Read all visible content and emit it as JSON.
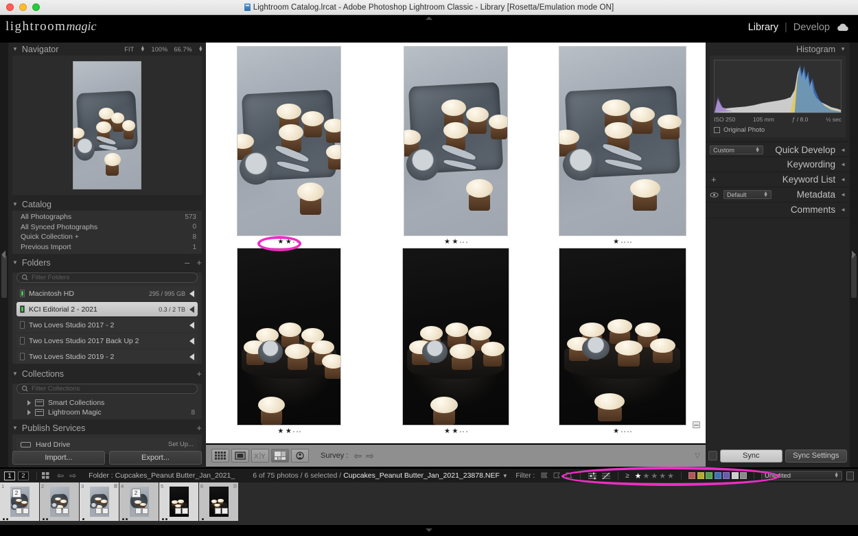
{
  "window": {
    "title": "Lightroom Catalog.lrcat - Adobe Photoshop Lightroom Classic - Library [Rosetta/Emulation mode ON]",
    "app_icon": "lightroom-icon"
  },
  "identity": {
    "plate_primary": "lightroom",
    "plate_italic": "magic"
  },
  "modules": {
    "library": "Library",
    "separator": "|",
    "develop": "Develop",
    "cloud_icon": "cloud-sync-icon"
  },
  "left": {
    "navigator": {
      "title": "Navigator",
      "zoom_fit": "FIT",
      "zoom_100": "100%",
      "zoom_custom": "66.7%"
    },
    "catalog": {
      "title": "Catalog",
      "rows": [
        {
          "label": "All Photographs",
          "count": "573"
        },
        {
          "label": "All Synced Photographs",
          "count": "0"
        },
        {
          "label": "Quick Collection +",
          "count": "8"
        },
        {
          "label": "Previous Import",
          "count": "1"
        }
      ]
    },
    "folders": {
      "title": "Folders",
      "filter_placeholder": "Filter Folders",
      "rows": [
        {
          "label": "Macintosh HD",
          "size": "295 / 995 GB",
          "online": true,
          "selected": false
        },
        {
          "label": "KCI Editorial 2 - 2021",
          "size": "0.3 / 2 TB",
          "online": true,
          "selected": true
        },
        {
          "label": "Two Loves Studio 2017 - 2",
          "size": "",
          "online": false,
          "selected": false
        },
        {
          "label": "Two Loves Studio 2017 Back Up 2",
          "size": "",
          "online": false,
          "selected": false
        },
        {
          "label": "Two Loves Studio 2019 - 2",
          "size": "",
          "online": false,
          "selected": false
        }
      ]
    },
    "collections": {
      "title": "Collections",
      "filter_placeholder": "Filter Collections",
      "rows": [
        {
          "label": "Smart Collections",
          "count": ""
        },
        {
          "label": "Lightroom Magic",
          "count": "8"
        }
      ]
    },
    "publish": {
      "title": "Publish Services",
      "service": "Hard Drive",
      "action": "Set Up..."
    },
    "import_label": "Import...",
    "export_label": "Export..."
  },
  "right": {
    "histogram": {
      "title": "Histogram",
      "iso": "ISO 250",
      "focal": "105 mm",
      "aperture": "ƒ / 8.0",
      "shutter": "½ sec",
      "original_photo": "Original Photo"
    },
    "panels": [
      {
        "title": "Quick Develop",
        "preset": "Custom"
      },
      {
        "title": "Keywording",
        "preset": ""
      },
      {
        "title": "Keyword List",
        "preset": ""
      },
      {
        "title": "Metadata",
        "preset": "Default"
      },
      {
        "title": "Comments",
        "preset": ""
      }
    ],
    "sync": "Sync",
    "sync_settings": "Sync Settings"
  },
  "grid": {
    "cells": [
      {
        "tone": "light",
        "rating": 2,
        "crop_badge": false
      },
      {
        "tone": "light",
        "rating": 2,
        "crop_badge": false
      },
      {
        "tone": "light",
        "rating": 1,
        "crop_badge": false
      },
      {
        "tone": "dark",
        "rating": 2,
        "crop_badge": false
      },
      {
        "tone": "dark",
        "rating": 2,
        "crop_badge": false
      },
      {
        "tone": "dark",
        "rating": 1,
        "crop_badge": true
      }
    ]
  },
  "toolbar": {
    "views": [
      "grid-view-icon",
      "loupe-view-icon",
      "compare-view-icon",
      "survey-view-icon",
      "people-view-icon"
    ],
    "label": "Survey :",
    "prev_icon": "arrow-left-icon",
    "next_icon": "arrow-right-icon",
    "caret_icon": "chevron-down-icon"
  },
  "filmstrip_bar": {
    "page_1": "1",
    "page_2": "2",
    "grid_icon": "grid-icon",
    "back_icon": "arrow-left-icon",
    "forward_icon": "arrow-right-icon",
    "folder_label": "Folder : Cupcakes_Peanut Butter_Jan_2021_",
    "count": "6 of 75 photos / 6 selected /",
    "filename": "Cupcakes_Peanut Butter_Jan_2021_23878.NEF",
    "filter_label": "Filter :",
    "flags": [
      "flag-pick-icon",
      "flag-unflagged-icon",
      "flag-rejected-icon"
    ],
    "sorts": [
      "sort-ascending-icon",
      "sort-descending-icon"
    ],
    "rating_operator": "≥",
    "rating_stars": 1,
    "rating_total": 5,
    "color_labels": [
      "#b05757",
      "#b5aa2e",
      "#55a04c",
      "#4070b4",
      "#6a5bb0",
      "#cccccc",
      "#8a8a8a"
    ],
    "preset_value": "Unedited",
    "lock_icon": "lock-filter-icon"
  },
  "filmstrip": {
    "items": [
      {
        "num": "1",
        "tone": "light",
        "dots": 2,
        "stack": "2",
        "badges": 2,
        "corner": false
      },
      {
        "num": "2",
        "tone": "light",
        "dots": 2,
        "stack": "",
        "badges": 2,
        "corner": false
      },
      {
        "num": "3",
        "tone": "light",
        "dots": 1,
        "stack": "",
        "badges": 2,
        "corner": true
      },
      {
        "num": "4",
        "tone": "light",
        "dots": 2,
        "stack": "2",
        "badges": 2,
        "corner": false
      },
      {
        "num": "5",
        "tone": "dark",
        "dots": 2,
        "stack": "",
        "badges": 2,
        "corner": false
      },
      {
        "num": "6",
        "tone": "dark",
        "dots": 1,
        "stack": "",
        "badges": 2,
        "corner": true
      }
    ]
  },
  "annotations": {
    "accent_color": "#ee2ec4",
    "ovals": [
      {
        "name": "rating-highlight-oval"
      },
      {
        "name": "filter-bar-highlight-oval"
      }
    ]
  }
}
